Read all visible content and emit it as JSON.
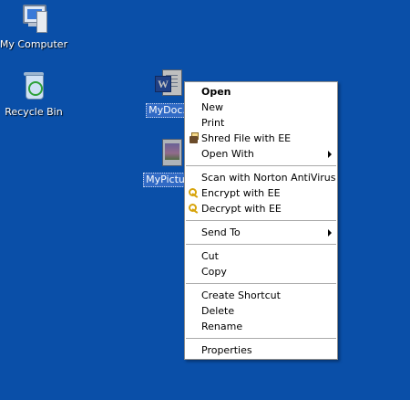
{
  "desktop": {
    "icons": [
      {
        "label": "My Computer",
        "selected": false
      },
      {
        "label": "Recycle Bin",
        "selected": false
      },
      {
        "label": "MyDoc.d",
        "selected": true
      },
      {
        "label": "MyPicture",
        "selected": true
      }
    ]
  },
  "context_menu": {
    "items": [
      {
        "label": "Open",
        "bold": true
      },
      {
        "label": "New"
      },
      {
        "label": "Print"
      },
      {
        "label": "Shred File with EE",
        "icon": "shredder-icon"
      },
      {
        "label": "Open With",
        "submenu": true
      },
      {
        "separator": true
      },
      {
        "label": "Scan with Norton AntiVirus"
      },
      {
        "label": "Encrypt with EE",
        "icon": "key-icon"
      },
      {
        "label": "Decrypt with EE",
        "icon": "key-icon"
      },
      {
        "separator": true
      },
      {
        "label": "Send To",
        "submenu": true
      },
      {
        "separator": true
      },
      {
        "label": "Cut"
      },
      {
        "label": "Copy"
      },
      {
        "separator": true
      },
      {
        "label": "Create Shortcut"
      },
      {
        "label": "Delete"
      },
      {
        "label": "Rename"
      },
      {
        "separator": true
      },
      {
        "label": "Properties"
      }
    ]
  },
  "colors": {
    "desktop_bg": "#0a4fa8",
    "selection": "#316ac5",
    "menu_bg": "#ffffff"
  }
}
